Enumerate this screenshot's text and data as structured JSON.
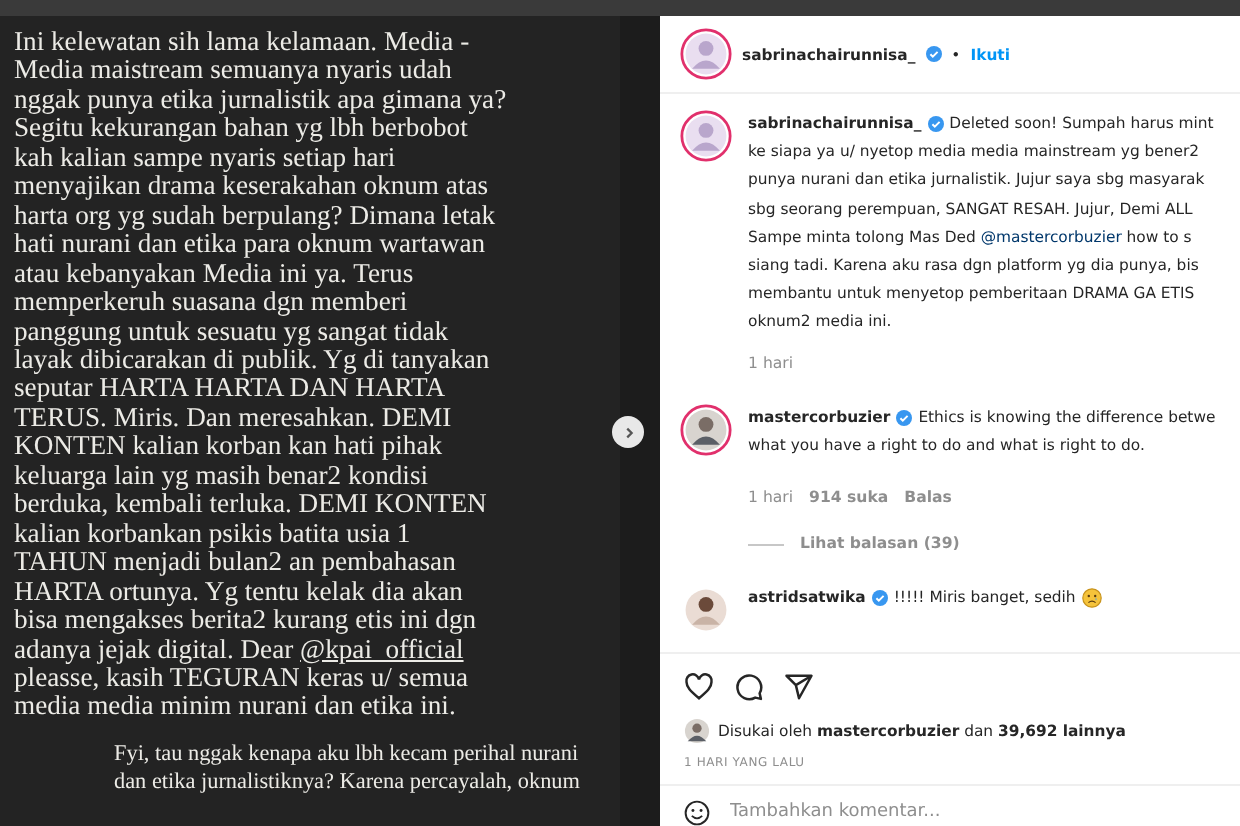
{
  "post_image": {
    "lines": [
      [
        {
          "kind": "text",
          "text": "Ini kelewatan sih lama kelamaan. Media -"
        }
      ],
      [
        {
          "kind": "text",
          "text": "Media maistream semuanya nyaris udah"
        }
      ],
      [
        {
          "kind": "text",
          "text": "nggak punya etika jurnalistik apa gimana ya?"
        }
      ],
      [
        {
          "kind": "text",
          "text": "Segitu kekurangan bahan yg lbh berbobot"
        }
      ],
      [
        {
          "kind": "text",
          "text": "kah kalian sampe nyaris setiap hari"
        }
      ],
      [
        {
          "kind": "text",
          "text": "menyajikan drama keserakahan oknum atas"
        }
      ],
      [
        {
          "kind": "text",
          "text": "harta org yg sudah berpulang? Dimana letak"
        }
      ],
      [
        {
          "kind": "text",
          "text": "hati nurani dan etika para oknum wartawan"
        }
      ],
      [
        {
          "kind": "text",
          "text": "atau kebanyakan Media ini ya. Terus"
        }
      ],
      [
        {
          "kind": "text",
          "text": "memperkeruh suasana dgn memberi"
        }
      ],
      [
        {
          "kind": "text",
          "text": "panggung untuk sesuatu yg sangat tidak"
        }
      ],
      [
        {
          "kind": "text",
          "text": "layak dibicarakan di publik. Yg di tanyakan"
        }
      ],
      [
        {
          "kind": "text",
          "text": "seputar HARTA HARTA DAN HARTA"
        }
      ],
      [
        {
          "kind": "text",
          "text": "TERUS. Miris. Dan meresahkan. DEMI"
        }
      ],
      [
        {
          "kind": "text",
          "text": "KONTEN kalian korban kan hati pihak"
        }
      ],
      [
        {
          "kind": "text",
          "text": "keluarga lain yg masih benar2  kondisi"
        }
      ],
      [
        {
          "kind": "text",
          "text": "berduka, kembali terluka. DEMI KONTEN"
        }
      ],
      [
        {
          "kind": "text",
          "text": "kalian korbankan psikis batita usia 1"
        }
      ],
      [
        {
          "kind": "text",
          "text": "TAHUN menjadi bulan2 an pembahasan"
        }
      ],
      [
        {
          "kind": "text",
          "text": "HARTA ortunya. Yg  tentu kelak dia akan"
        }
      ],
      [
        {
          "kind": "text",
          "text": "bisa mengakses berita2 kurang etis ini dgn"
        }
      ],
      [
        {
          "kind": "text",
          "text": "adanya jejak digital. Dear "
        },
        {
          "kind": "mention",
          "text": "@kpai_official"
        }
      ],
      [
        {
          "kind": "text",
          "text": "pleasse, kasih TEGURAN keras u/ semua"
        }
      ],
      [
        {
          "kind": "text",
          "text": "media media minim nurani dan etika ini."
        }
      ]
    ],
    "footer_lines": [
      "Fyi, tau nggak kenapa aku lbh kecam perihal nurani",
      "dan etika jurnalistiknya? Karena percayalah, oknum"
    ]
  },
  "header": {
    "username": "sabrinachairunnisa_",
    "verified": true,
    "separator": "•",
    "follow": "Ikuti"
  },
  "caption": {
    "username": "sabrinachairunnisa_",
    "verified": true,
    "lines": [
      [
        {
          "kind": "text",
          "text": "Deleted soon! Sumpah harus mint"
        }
      ],
      [
        {
          "kind": "text",
          "text": "ke siapa ya u/ nyetop media media mainstream yg bener2"
        }
      ],
      [
        {
          "kind": "text",
          "text": "punya nurani dan etika jurnalistik. Jujur saya sbg masyarak"
        }
      ],
      [
        {
          "kind": "text",
          "text": "sbg seorang perempuan, SANGAT RESAH. Jujur, Demi ALL"
        }
      ],
      [
        {
          "kind": "text",
          "text": "Sampe minta tolong Mas Ded "
        },
        {
          "kind": "mention",
          "text": "@mastercorbuzier"
        },
        {
          "kind": "text",
          "text": " how to s"
        }
      ],
      [
        {
          "kind": "text",
          "text": "siang tadi. Karena aku rasa dgn platform yg dia punya, bis"
        }
      ],
      [
        {
          "kind": "text",
          "text": "membantu untuk menyetop pemberitaan DRAMA GA ETIS"
        }
      ],
      [
        {
          "kind": "text",
          "text": "oknum2 media ini."
        }
      ]
    ],
    "time": "1 hari"
  },
  "comments": [
    {
      "username": "mastercorbuzier",
      "verified": true,
      "text": "Ethics is knowing the difference betwe",
      "text_line2": "what you have a right to do and what is right to do.",
      "time": "1 hari",
      "likes": "914 suka",
      "reply": "Balas",
      "view_replies": "Lihat balasan (39)"
    },
    {
      "username": "astridsatwika",
      "verified": true,
      "text": "!!!!! Miris banget, sedih",
      "emoji": true
    }
  ],
  "likes": {
    "prefix": "Disukai oleh",
    "user": "mastercorbuzier",
    "middle": "dan",
    "count": "39,692 lainnya"
  },
  "timestamp": "1 HARI YANG LALU",
  "comment_field": {
    "placeholder": "Tambahkan komentar..."
  }
}
